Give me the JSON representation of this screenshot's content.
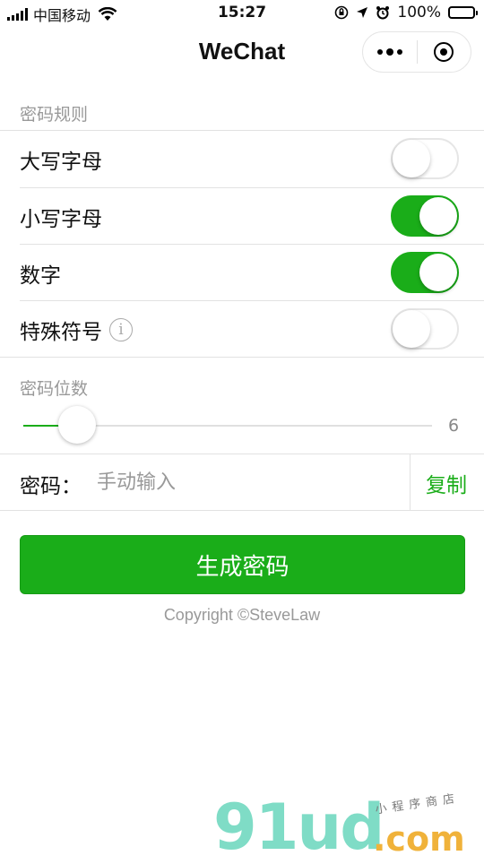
{
  "status_bar": {
    "carrier": "中国移动",
    "time": "15:27",
    "battery": "100%"
  },
  "nav": {
    "title": "WeChat"
  },
  "rules": {
    "title": "密码规则",
    "items": [
      {
        "label": "大写字母",
        "on": false
      },
      {
        "label": "小写字母",
        "on": true
      },
      {
        "label": "数字",
        "on": true
      },
      {
        "label": "特殊符号",
        "on": false,
        "info": "i"
      }
    ]
  },
  "length": {
    "title": "密码位数",
    "value": "6",
    "fraction": 0.132
  },
  "password": {
    "label": "密码：",
    "placeholder": "手动输入",
    "copy_label": "复制"
  },
  "generate_label": "生成密码",
  "copyright": "Copyright ©SteveLaw",
  "watermark": {
    "main": "91ud",
    "dotcom": ".com",
    "tagline": "小程序商店"
  },
  "colors": {
    "accent": "#1aad19"
  }
}
